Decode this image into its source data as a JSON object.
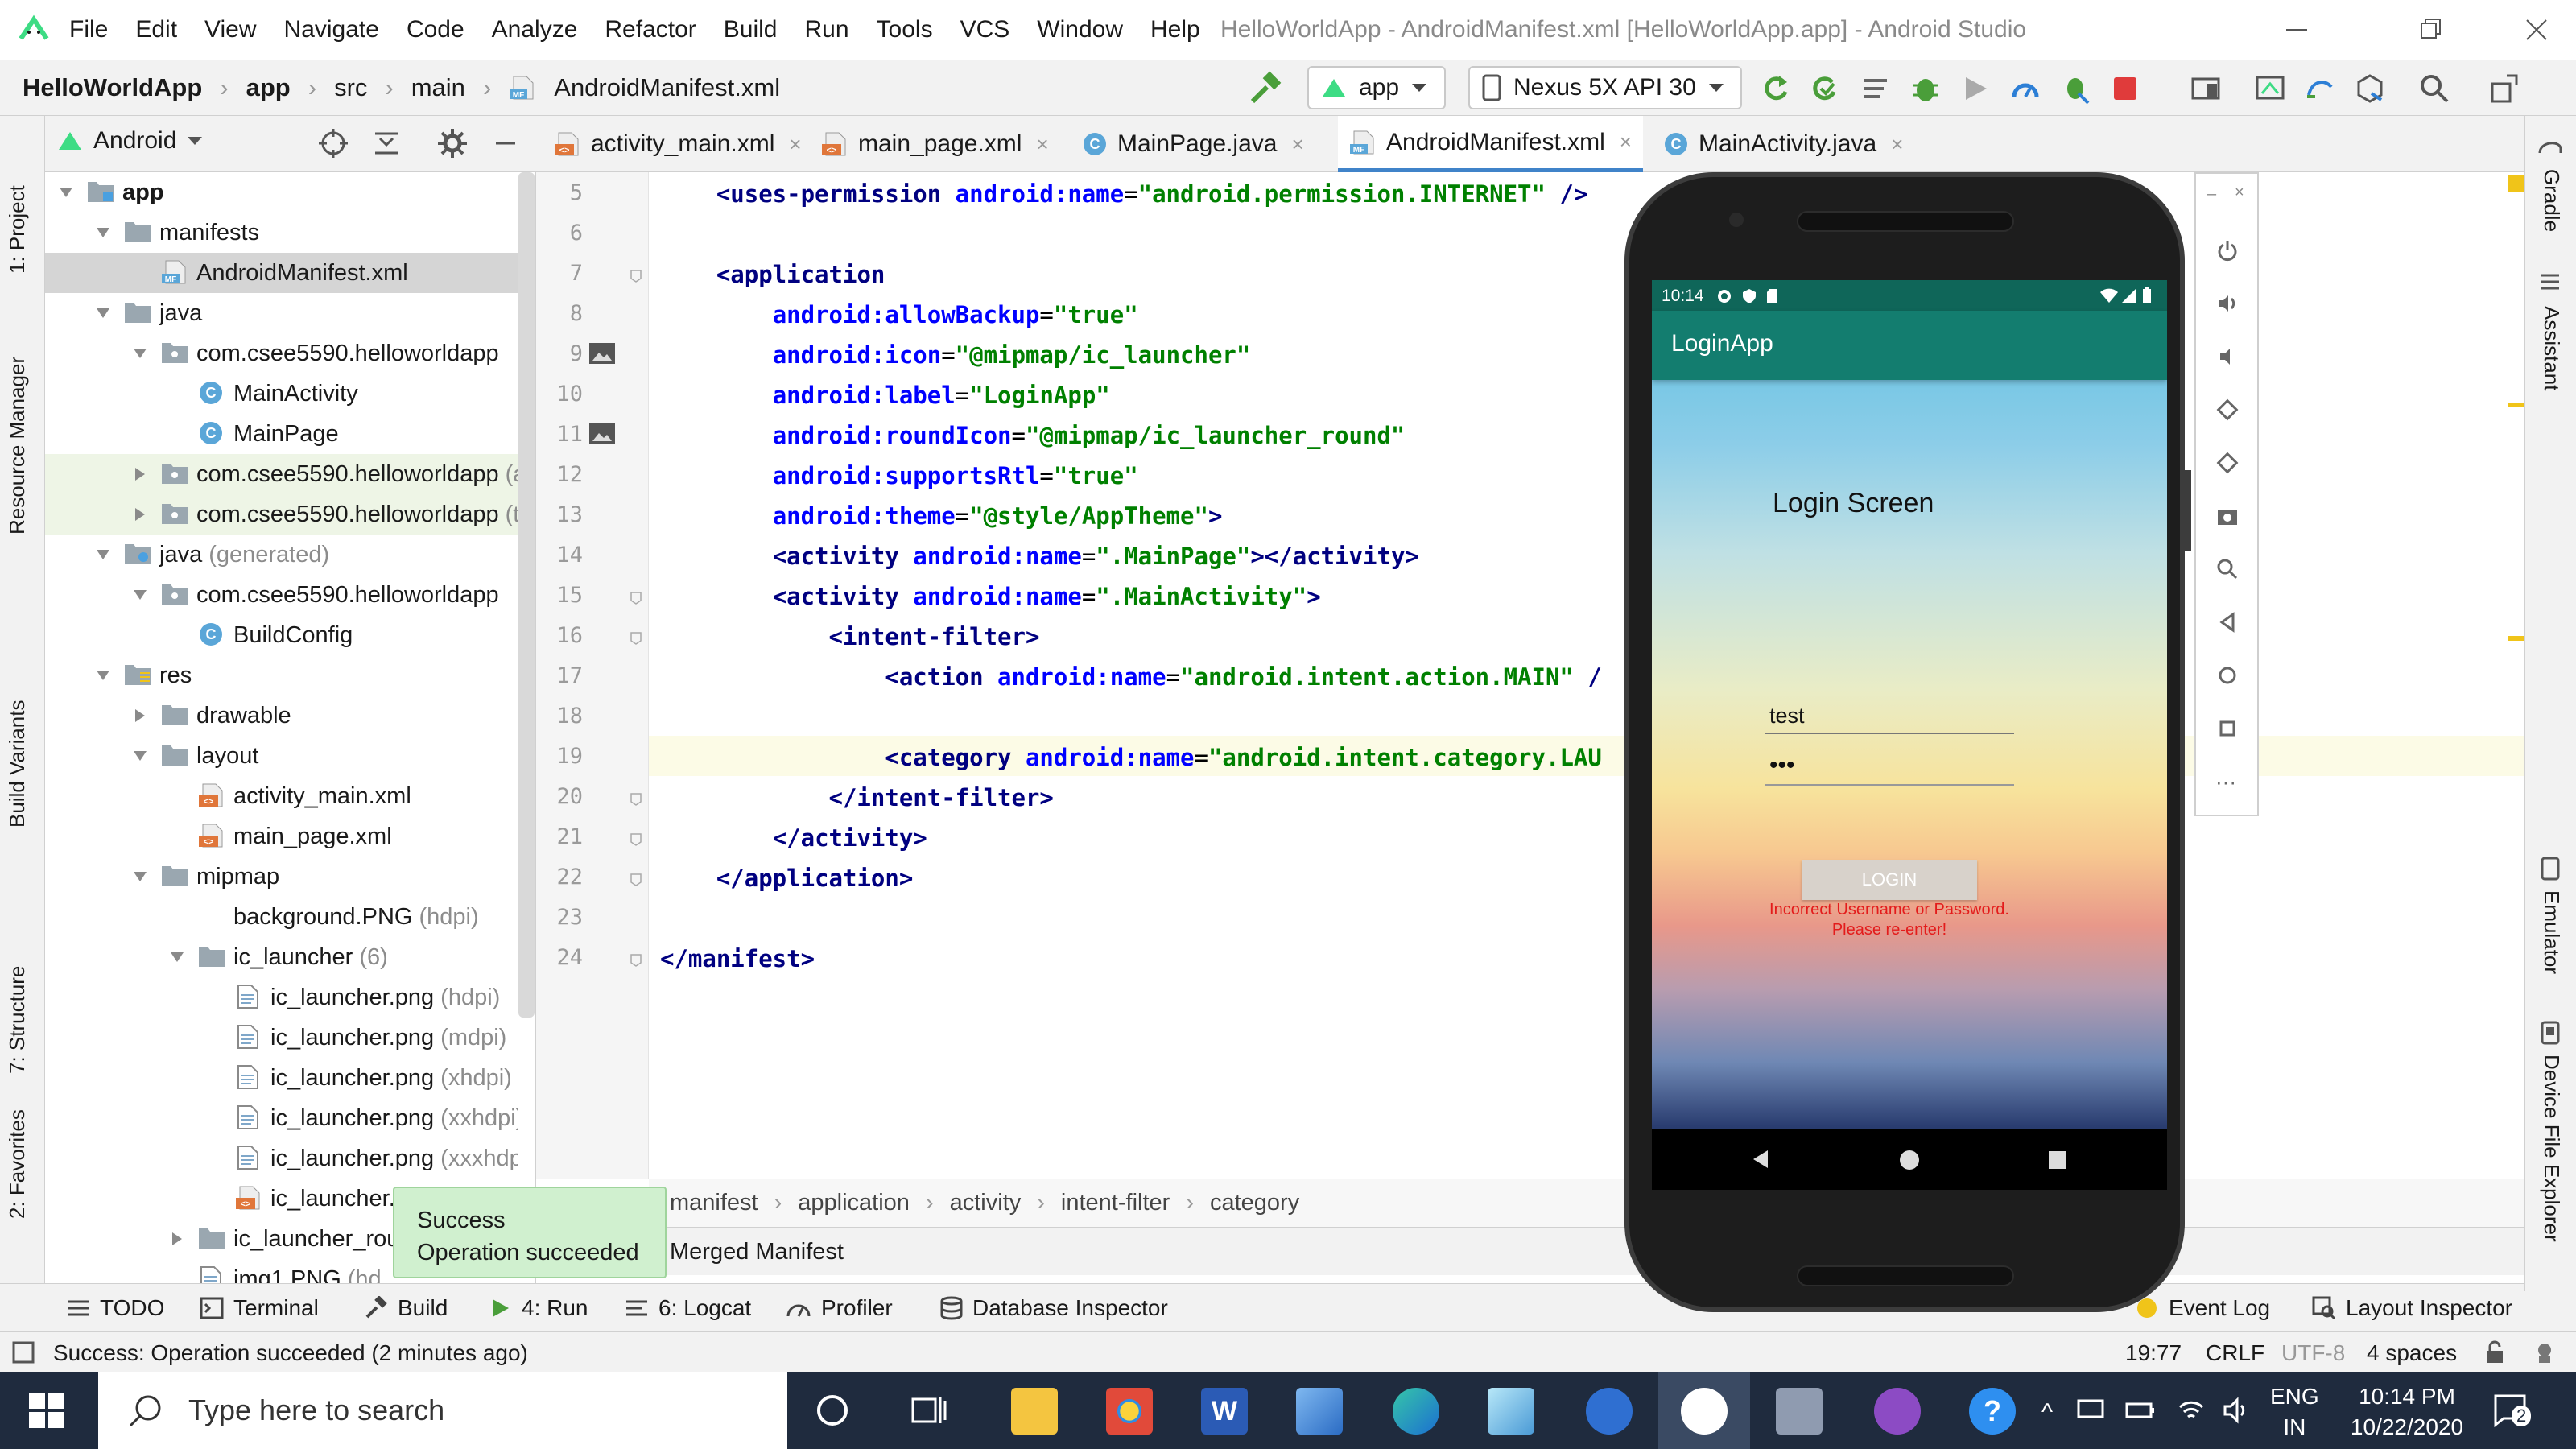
{
  "window": {
    "menu": [
      "File",
      "Edit",
      "View",
      "Navigate",
      "Code",
      "Analyze",
      "Refactor",
      "Build",
      "Run",
      "Tools",
      "VCS",
      "Window",
      "Help"
    ],
    "title": "HelloWorldApp - AndroidManifest.xml [HelloWorldApp.app] - Android Studio"
  },
  "nav": {
    "breadcrumbs": [
      "HelloWorldApp",
      "app",
      "src",
      "main",
      "AndroidManifest.xml"
    ],
    "run_config": "app",
    "device": "Nexus 5X API 30"
  },
  "left_stripe": [
    "1: Project",
    "Resource Manager",
    "Build Variants",
    "7: Structure",
    "2: Favorites"
  ],
  "right_stripe": [
    "Gradle",
    "Assistant",
    "Emulator",
    "Device File Explorer"
  ],
  "project": {
    "view_mode": "Android",
    "tree": [
      {
        "label": "app",
        "depth": 0,
        "arrow": "down",
        "icon": "module",
        "bold": true
      },
      {
        "label": "manifests",
        "depth": 1,
        "arrow": "down",
        "icon": "folder"
      },
      {
        "label": "AndroidManifest.xml",
        "depth": 2,
        "arrow": "",
        "icon": "manifest",
        "selected": true
      },
      {
        "label": "java",
        "depth": 1,
        "arrow": "down",
        "icon": "folder"
      },
      {
        "label": "com.csee5590.helloworldapp",
        "depth": 2,
        "arrow": "down",
        "icon": "package"
      },
      {
        "label": "MainActivity",
        "depth": 3,
        "arrow": "",
        "icon": "class"
      },
      {
        "label": "MainPage",
        "depth": 3,
        "arrow": "",
        "icon": "class"
      },
      {
        "label": "com.csee5590.helloworldapp",
        "extra": "(a",
        "depth": 2,
        "arrow": "right",
        "icon": "package",
        "tint": true
      },
      {
        "label": "com.csee5590.helloworldapp",
        "extra": "(te",
        "depth": 2,
        "arrow": "right",
        "icon": "package",
        "tint": true
      },
      {
        "label": "java",
        "extra": "(generated)",
        "depth": 1,
        "arrow": "down",
        "icon": "folder-gen"
      },
      {
        "label": "com.csee5590.helloworldapp",
        "depth": 2,
        "arrow": "down",
        "icon": "package"
      },
      {
        "label": "BuildConfig",
        "depth": 3,
        "arrow": "",
        "icon": "class"
      },
      {
        "label": "res",
        "depth": 1,
        "arrow": "down",
        "icon": "folder-res"
      },
      {
        "label": "drawable",
        "depth": 2,
        "arrow": "right",
        "icon": "folder"
      },
      {
        "label": "layout",
        "depth": 2,
        "arrow": "down",
        "icon": "folder"
      },
      {
        "label": "activity_main.xml",
        "depth": 3,
        "arrow": "",
        "icon": "xml"
      },
      {
        "label": "main_page.xml",
        "depth": 3,
        "arrow": "",
        "icon": "xml"
      },
      {
        "label": "mipmap",
        "depth": 2,
        "arrow": "down",
        "icon": "folder"
      },
      {
        "label": "background.PNG",
        "extra": "(hdpi)",
        "depth": 3,
        "arrow": "",
        "icon": "none"
      },
      {
        "label": "ic_launcher",
        "extra": "(6)",
        "depth": 3,
        "arrow": "down",
        "icon": "folder"
      },
      {
        "label": "ic_launcher.png",
        "extra": "(hdpi)",
        "depth": 4,
        "arrow": "",
        "icon": "image"
      },
      {
        "label": "ic_launcher.png",
        "extra": "(mdpi)",
        "depth": 4,
        "arrow": "",
        "icon": "image"
      },
      {
        "label": "ic_launcher.png",
        "extra": "(xhdpi)",
        "depth": 4,
        "arrow": "",
        "icon": "image"
      },
      {
        "label": "ic_launcher.png",
        "extra": "(xxhdpi)",
        "depth": 4,
        "arrow": "",
        "icon": "image"
      },
      {
        "label": "ic_launcher.png",
        "extra": "(xxxhdpi)",
        "depth": 4,
        "arrow": "",
        "icon": "image"
      },
      {
        "label": "ic_launcher.",
        "depth": 4,
        "arrow": "",
        "icon": "xml"
      },
      {
        "label": "ic_launcher_rou",
        "depth": 3,
        "arrow": "right",
        "icon": "folder"
      },
      {
        "label": "img1.PNG",
        "extra": "(hd",
        "depth": 3,
        "arrow": "",
        "icon": "image"
      }
    ]
  },
  "tabs": [
    {
      "label": "activity_main.xml",
      "icon": "xml"
    },
    {
      "label": "main_page.xml",
      "icon": "xml"
    },
    {
      "label": "MainPage.java",
      "icon": "class"
    },
    {
      "label": "AndroidManifest.xml",
      "icon": "manifest",
      "active": true
    },
    {
      "label": "MainActivity.java",
      "icon": "class"
    }
  ],
  "editor": {
    "line_numbers": [
      "5",
      "6",
      "7",
      "8",
      "9",
      "10",
      "11",
      "12",
      "13",
      "14",
      "15",
      "16",
      "17",
      "18",
      "19",
      "20",
      "21",
      "22",
      "23",
      "24"
    ],
    "lines": [
      [
        {
          "t": "    ",
          "c": "pl"
        },
        {
          "t": "<uses-permission ",
          "c": "tag"
        },
        {
          "t": "android:name",
          "c": "attr"
        },
        {
          "t": "=",
          "c": "pl"
        },
        {
          "t": "\"android.permission.INTERNET\"",
          "c": "val"
        },
        {
          "t": " />",
          "c": "tag"
        }
      ],
      [],
      [
        {
          "t": "    ",
          "c": "pl"
        },
        {
          "t": "<application",
          "c": "tag"
        }
      ],
      [
        {
          "t": "        ",
          "c": "pl"
        },
        {
          "t": "android:allowBackup",
          "c": "attr"
        },
        {
          "t": "=",
          "c": "pl"
        },
        {
          "t": "\"true\"",
          "c": "val"
        }
      ],
      [
        {
          "t": "        ",
          "c": "pl"
        },
        {
          "t": "android:icon",
          "c": "attr"
        },
        {
          "t": "=",
          "c": "pl"
        },
        {
          "t": "\"@mipmap/ic_launcher\"",
          "c": "val"
        }
      ],
      [
        {
          "t": "        ",
          "c": "pl"
        },
        {
          "t": "android:label",
          "c": "attr"
        },
        {
          "t": "=",
          "c": "pl"
        },
        {
          "t": "\"LoginApp\"",
          "c": "val"
        }
      ],
      [
        {
          "t": "        ",
          "c": "pl"
        },
        {
          "t": "android:roundIcon",
          "c": "attr"
        },
        {
          "t": "=",
          "c": "pl"
        },
        {
          "t": "\"@mipmap/ic_launcher_round\"",
          "c": "val"
        }
      ],
      [
        {
          "t": "        ",
          "c": "pl"
        },
        {
          "t": "android:supportsRtl",
          "c": "attr"
        },
        {
          "t": "=",
          "c": "pl"
        },
        {
          "t": "\"true\"",
          "c": "val"
        }
      ],
      [
        {
          "t": "        ",
          "c": "pl"
        },
        {
          "t": "android:theme",
          "c": "attr"
        },
        {
          "t": "=",
          "c": "pl"
        },
        {
          "t": "\"@style/AppTheme\"",
          "c": "val"
        },
        {
          "t": ">",
          "c": "tag"
        }
      ],
      [
        {
          "t": "        ",
          "c": "pl"
        },
        {
          "t": "<activity ",
          "c": "tag"
        },
        {
          "t": "android:name",
          "c": "attr"
        },
        {
          "t": "=",
          "c": "pl"
        },
        {
          "t": "\".MainPage\"",
          "c": "val"
        },
        {
          "t": "></activity>",
          "c": "tag"
        }
      ],
      [
        {
          "t": "        ",
          "c": "pl"
        },
        {
          "t": "<activity ",
          "c": "tag"
        },
        {
          "t": "android:name",
          "c": "attr"
        },
        {
          "t": "=",
          "c": "pl"
        },
        {
          "t": "\".MainActivity\"",
          "c": "val"
        },
        {
          "t": ">",
          "c": "tag"
        }
      ],
      [
        {
          "t": "            ",
          "c": "pl"
        },
        {
          "t": "<intent-filter>",
          "c": "tag"
        }
      ],
      [
        {
          "t": "                ",
          "c": "pl"
        },
        {
          "t": "<action ",
          "c": "tag"
        },
        {
          "t": "android:name",
          "c": "attr"
        },
        {
          "t": "=",
          "c": "pl"
        },
        {
          "t": "\"android.intent.action.MAIN\"",
          "c": "val"
        },
        {
          "t": " /",
          "c": "tag"
        }
      ],
      [],
      [
        {
          "t": "                ",
          "c": "pl"
        },
        {
          "t": "<category ",
          "c": "tag"
        },
        {
          "t": "android:name",
          "c": "attr"
        },
        {
          "t": "=",
          "c": "pl"
        },
        {
          "t": "\"android.intent.category.LAU",
          "c": "val"
        }
      ],
      [
        {
          "t": "            ",
          "c": "pl"
        },
        {
          "t": "</intent-filter>",
          "c": "tag"
        }
      ],
      [
        {
          "t": "        ",
          "c": "pl"
        },
        {
          "t": "</activity>",
          "c": "tag"
        }
      ],
      [
        {
          "t": "    ",
          "c": "pl"
        },
        {
          "t": "</application>",
          "c": "tag"
        }
      ],
      [],
      [
        {
          "t": "</manifest>",
          "c": "tag"
        }
      ]
    ],
    "breadcrumb": [
      "manifest",
      "application",
      "activity",
      "intent-filter",
      "category"
    ],
    "merged_tab": "Merged Manifest"
  },
  "toast": {
    "title": "Success",
    "message": "Operation succeeded"
  },
  "bottom_tools": [
    "TODO",
    "Terminal",
    "Build",
    "4: Run",
    "6: Logcat",
    "Profiler",
    "Database Inspector"
  ],
  "bottom_right_tools": [
    "Event Log",
    "Layout Inspector"
  ],
  "status": {
    "message": "Success: Operation succeeded (2 minutes ago)",
    "position": "19:77",
    "line_sep": "CRLF",
    "encoding": "UTF-8",
    "indent": "4 spaces"
  },
  "phone": {
    "time": "10:14",
    "app_title": "LoginApp",
    "screen_title": "Login Screen",
    "username": "test",
    "password": "•••",
    "login_button": "LOGIN",
    "error": [
      "Incorrect Username or Password.",
      "Please re-enter!"
    ],
    "app_bar_color": "#137d6f"
  },
  "taskbar": {
    "search_placeholder": "Type here to search",
    "lang": "ENG",
    "region": "IN",
    "time": "10:14 PM",
    "date": "10/22/2020",
    "notifications": "2"
  }
}
